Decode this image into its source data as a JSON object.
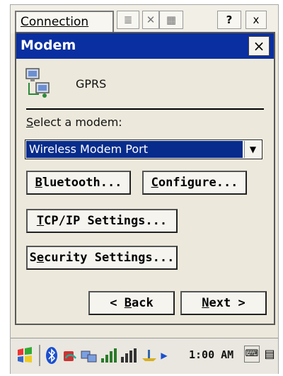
{
  "topbar": {
    "connection_label": "Connection",
    "help_label": "?",
    "close_label": "x"
  },
  "dialog": {
    "title": "Modem",
    "close_label": "×",
    "connection_type": "GPRS",
    "select_label_prefix": "S",
    "select_label_rest": "elect a modem:",
    "modem_value": "Wireless Modem Port",
    "bluetooth_prefix": "B",
    "bluetooth_rest": "luetooth...",
    "configure_prefix": "C",
    "configure_rest": "onfigure...",
    "tcpip_prefix": "T",
    "tcpip_rest": "CP/IP Settings...",
    "security_a": "S",
    "security_u": "e",
    "security_b": "curity Settings...",
    "back_a": "< ",
    "back_u": "B",
    "back_b": "ack",
    "next_u": "N",
    "next_b": "ext >"
  },
  "taskbar": {
    "time": "1:00 AM"
  },
  "icons": [
    "start-icon",
    "bluetooth-icon",
    "activesync-icon",
    "network-icon",
    "signal-icon",
    "battery-icon",
    "volume-icon",
    "keyboard-icon",
    "taskswitch-icon"
  ]
}
